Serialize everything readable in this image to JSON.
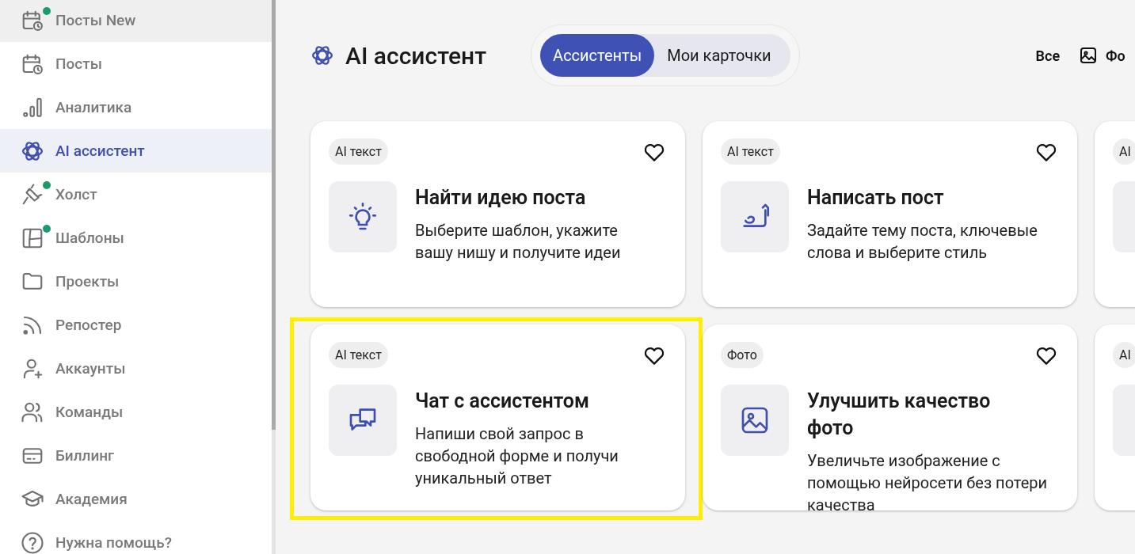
{
  "sidebar": {
    "items": [
      {
        "label": "Посты New",
        "selected": false,
        "hovered": true,
        "new_dot": true
      },
      {
        "label": "Посты",
        "selected": false,
        "hovered": false,
        "new_dot": false
      },
      {
        "label": "Аналитика",
        "selected": false,
        "hovered": false,
        "new_dot": false
      },
      {
        "label": "AI ассистент",
        "selected": true,
        "hovered": false,
        "new_dot": false
      },
      {
        "label": "Холст",
        "selected": false,
        "hovered": false,
        "new_dot": true
      },
      {
        "label": "Шаблоны",
        "selected": false,
        "hovered": false,
        "new_dot": true
      },
      {
        "label": "Проекты",
        "selected": false,
        "hovered": false,
        "new_dot": false
      },
      {
        "label": "Репостер",
        "selected": false,
        "hovered": false,
        "new_dot": false
      },
      {
        "label": "Аккаунты",
        "selected": false,
        "hovered": false,
        "new_dot": false
      },
      {
        "label": "Команды",
        "selected": false,
        "hovered": false,
        "new_dot": false
      },
      {
        "label": "Биллинг",
        "selected": false,
        "hovered": false,
        "new_dot": false
      },
      {
        "label": "Академия",
        "selected": false,
        "hovered": false,
        "new_dot": false
      },
      {
        "label": "Нужна помощь?",
        "selected": false,
        "hovered": false,
        "new_dot": false
      }
    ]
  },
  "header": {
    "title": "AI ассистент",
    "tabs": [
      {
        "label": "Ассистенты",
        "selected": true
      },
      {
        "label": "Мои карточки",
        "selected": false
      }
    ],
    "filters": [
      {
        "kind": "text",
        "label": "Все"
      },
      {
        "kind": "image",
        "label": "Фо"
      }
    ]
  },
  "cards": [
    {
      "tag": "AI текст",
      "title": "Найти идею поста",
      "description": "Выберите шаблон, укажите вашу нишу и получите идеи",
      "highlighted": false
    },
    {
      "tag": "AI текст",
      "title": "Написать пост",
      "description": "Задайте тему поста, ключевые слова и выберите стиль",
      "highlighted": false
    },
    {
      "tag": "AI",
      "highlighted": false
    },
    {
      "tag": "AI текст",
      "title": "Чат с ассистентом",
      "description": "Напиши свой запрос в свободной форме и получи уникальный ответ",
      "highlighted": true
    },
    {
      "tag": "Фото",
      "title": "Улучшить качество фото",
      "description": "Увеличьте изображение с помощью нейросети без потери качества",
      "highlighted": false
    },
    {
      "tag": "AI",
      "highlighted": false
    }
  ]
}
